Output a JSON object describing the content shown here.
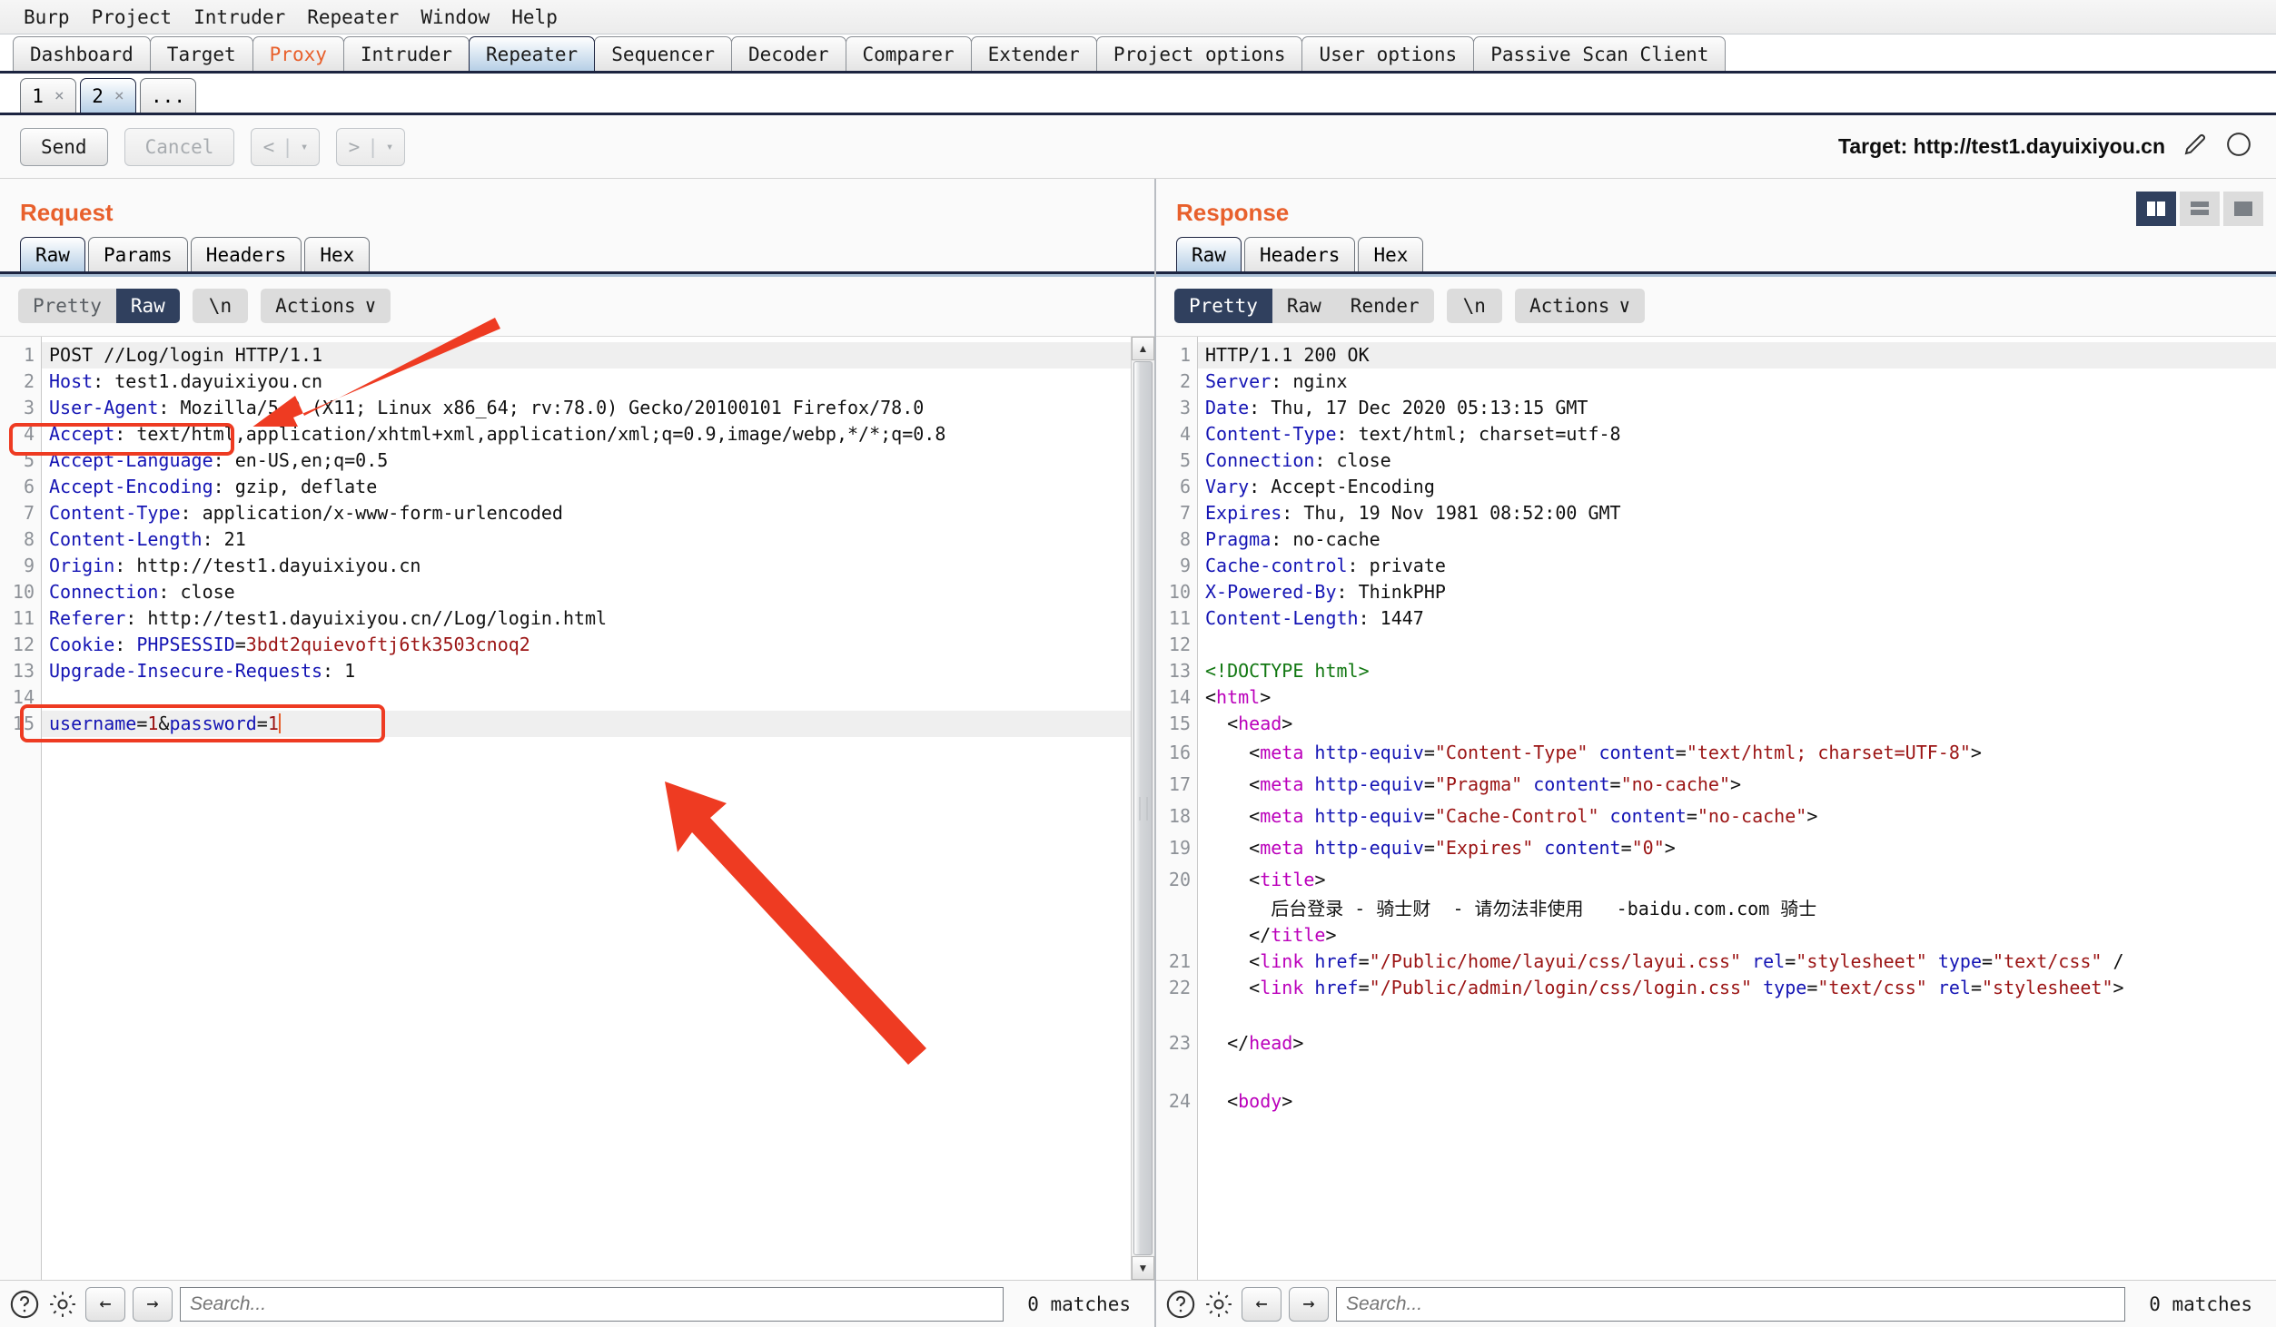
{
  "menu": {
    "items": [
      "Burp",
      "Project",
      "Intruder",
      "Repeater",
      "Window",
      "Help"
    ]
  },
  "main_tabs": [
    {
      "label": "Dashboard",
      "active": false
    },
    {
      "label": "Target",
      "active": false
    },
    {
      "label": "Proxy",
      "active": false
    },
    {
      "label": "Intruder",
      "active": false
    },
    {
      "label": "Repeater",
      "active": true
    },
    {
      "label": "Sequencer",
      "active": false
    },
    {
      "label": "Decoder",
      "active": false
    },
    {
      "label": "Comparer",
      "active": false
    },
    {
      "label": "Extender",
      "active": false
    },
    {
      "label": "Project options",
      "active": false
    },
    {
      "label": "User options",
      "active": false
    },
    {
      "label": "Passive Scan Client",
      "active": false
    }
  ],
  "repeater_tabs": [
    {
      "label": "1",
      "close": "×",
      "active": false
    },
    {
      "label": "2",
      "close": "×",
      "active": true
    },
    {
      "label": "...",
      "close": "",
      "active": false
    }
  ],
  "action_bar": {
    "send_label": "Send",
    "cancel_label": "Cancel",
    "back_label": "<",
    "forward_label": ">",
    "dropdown_glyph": "▾",
    "separator": "|",
    "target_label": "Target: http://test1.dayuixiyou.cn"
  },
  "request": {
    "title": "Request",
    "tabs": [
      {
        "label": "Raw",
        "active": true
      },
      {
        "label": "Params",
        "active": false
      },
      {
        "label": "Headers",
        "active": false
      },
      {
        "label": "Hex",
        "active": false
      }
    ],
    "view_modes": [
      {
        "label": "Pretty",
        "state": "dim"
      },
      {
        "label": "Raw",
        "state": "on"
      }
    ],
    "newline_label": "\\n",
    "actions_label": "Actions",
    "actions_chevron": "∨",
    "lines": [
      {
        "n": "1",
        "highlight": true,
        "tokens": [
          {
            "t": "POST //Log/login HTTP/1.1",
            "c": "val"
          }
        ]
      },
      {
        "n": "2",
        "highlight": false,
        "tokens": [
          {
            "t": "Host",
            "c": "hdr"
          },
          {
            "t": ": test1.dayuixiyou.cn",
            "c": "val"
          }
        ]
      },
      {
        "n": "3",
        "highlight": false,
        "tokens": [
          {
            "t": "User-Agent",
            "c": "hdr"
          },
          {
            "t": ": Mozilla/5.0 (X11; Linux x86_64; rv:78.0) Gecko/20100101 Firefox/78.0",
            "c": "val"
          }
        ]
      },
      {
        "n": "4",
        "highlight": false,
        "tokens": [
          {
            "t": "Accept",
            "c": "hdr"
          },
          {
            "t": ": text/html,application/xhtml+xml,application/xml;q=0.9,image/webp,*/*;q=0.8",
            "c": "val"
          }
        ]
      },
      {
        "n": "5",
        "highlight": false,
        "tokens": [
          {
            "t": "Accept-Language",
            "c": "hdr"
          },
          {
            "t": ": en-US,en;q=0.5",
            "c": "val"
          }
        ]
      },
      {
        "n": "6",
        "highlight": false,
        "tokens": [
          {
            "t": "Accept-Encoding",
            "c": "hdr"
          },
          {
            "t": ": gzip, deflate",
            "c": "val"
          }
        ]
      },
      {
        "n": "7",
        "highlight": false,
        "tokens": [
          {
            "t": "Content-Type",
            "c": "hdr"
          },
          {
            "t": ": application/x-www-form-urlencoded",
            "c": "val"
          }
        ]
      },
      {
        "n": "8",
        "highlight": false,
        "tokens": [
          {
            "t": "Content-Length",
            "c": "hdr"
          },
          {
            "t": ": 21",
            "c": "val"
          }
        ]
      },
      {
        "n": "9",
        "highlight": false,
        "tokens": [
          {
            "t": "Origin",
            "c": "hdr"
          },
          {
            "t": ": http://test1.dayuixiyou.cn",
            "c": "val"
          }
        ]
      },
      {
        "n": "10",
        "highlight": false,
        "tokens": [
          {
            "t": "Connection",
            "c": "hdr"
          },
          {
            "t": ": close",
            "c": "val"
          }
        ]
      },
      {
        "n": "11",
        "highlight": false,
        "tokens": [
          {
            "t": "Referer",
            "c": "hdr"
          },
          {
            "t": ": http://test1.dayuixiyou.cn//Log/login.html",
            "c": "val"
          }
        ]
      },
      {
        "n": "12",
        "highlight": false,
        "tokens": [
          {
            "t": "Cookie",
            "c": "hdr"
          },
          {
            "t": ": ",
            "c": "val"
          },
          {
            "t": "PHPSESSID",
            "c": "hdr"
          },
          {
            "t": "=",
            "c": "val"
          },
          {
            "t": "3bdt2quievoftj6tk3503cnoq2",
            "c": "cookieval"
          }
        ]
      },
      {
        "n": "13",
        "highlight": false,
        "tokens": [
          {
            "t": "Upgrade-Insecure-Requests",
            "c": "hdr"
          },
          {
            "t": ": 1",
            "c": "val"
          }
        ]
      },
      {
        "n": "14",
        "highlight": false,
        "tokens": [
          {
            "t": "",
            "c": "val"
          }
        ]
      },
      {
        "n": "15",
        "highlight": true,
        "tokens": [
          {
            "t": "username",
            "c": "hdr"
          },
          {
            "t": "=",
            "c": "val"
          },
          {
            "t": "1",
            "c": "aval"
          },
          {
            "t": "&",
            "c": "val"
          },
          {
            "t": "password",
            "c": "hdr"
          },
          {
            "t": "=",
            "c": "val"
          },
          {
            "t": "1",
            "c": "aval"
          }
        ],
        "caret": true
      }
    ],
    "search_placeholder": "Search...",
    "matches_label": "0 matches",
    "help_icon": "?",
    "gear_icon": "gear",
    "prev_icon": "←",
    "next_icon": "→"
  },
  "response": {
    "title": "Response",
    "tabs": [
      {
        "label": "Raw",
        "active": true
      },
      {
        "label": "Headers",
        "active": false
      },
      {
        "label": "Hex",
        "active": false
      }
    ],
    "view_modes": [
      {
        "label": "Pretty",
        "state": "on"
      },
      {
        "label": "Raw",
        "state": "plain"
      },
      {
        "label": "Render",
        "state": "plain"
      }
    ],
    "newline_label": "\\n",
    "actions_label": "Actions",
    "actions_chevron": "∨",
    "layout_buttons": [
      {
        "name": "split-vertical",
        "active": true
      },
      {
        "name": "split-horizontal",
        "active": false
      },
      {
        "name": "single-pane",
        "active": false
      }
    ],
    "lines": [
      {
        "n": "1",
        "highlight": true,
        "tall": false,
        "tokens": [
          {
            "t": "HTTP/1.1 200 OK",
            "c": "val"
          }
        ]
      },
      {
        "n": "2",
        "highlight": false,
        "tall": false,
        "tokens": [
          {
            "t": "Server",
            "c": "hdr"
          },
          {
            "t": ": nginx",
            "c": "val"
          }
        ]
      },
      {
        "n": "3",
        "highlight": false,
        "tall": false,
        "tokens": [
          {
            "t": "Date",
            "c": "hdr"
          },
          {
            "t": ": Thu, 17 Dec 2020 05:13:15 GMT",
            "c": "val"
          }
        ]
      },
      {
        "n": "4",
        "highlight": false,
        "tall": false,
        "tokens": [
          {
            "t": "Content-Type",
            "c": "hdr"
          },
          {
            "t": ": text/html; charset=utf-8",
            "c": "val"
          }
        ]
      },
      {
        "n": "5",
        "highlight": false,
        "tall": false,
        "tokens": [
          {
            "t": "Connection",
            "c": "hdr"
          },
          {
            "t": ": close",
            "c": "val"
          }
        ]
      },
      {
        "n": "6",
        "highlight": false,
        "tall": false,
        "tokens": [
          {
            "t": "Vary",
            "c": "hdr"
          },
          {
            "t": ": Accept-Encoding",
            "c": "val"
          }
        ]
      },
      {
        "n": "7",
        "highlight": false,
        "tall": false,
        "tokens": [
          {
            "t": "Expires",
            "c": "hdr"
          },
          {
            "t": ": Thu, 19 Nov 1981 08:52:00 GMT",
            "c": "val"
          }
        ]
      },
      {
        "n": "8",
        "highlight": false,
        "tall": false,
        "tokens": [
          {
            "t": "Pragma",
            "c": "hdr"
          },
          {
            "t": ": no-cache",
            "c": "val"
          }
        ]
      },
      {
        "n": "9",
        "highlight": false,
        "tall": false,
        "tokens": [
          {
            "t": "Cache-control",
            "c": "hdr"
          },
          {
            "t": ": private",
            "c": "val"
          }
        ]
      },
      {
        "n": "10",
        "highlight": false,
        "tall": false,
        "tokens": [
          {
            "t": "X-Powered-By",
            "c": "hdr"
          },
          {
            "t": ": ThinkPHP",
            "c": "val"
          }
        ]
      },
      {
        "n": "11",
        "highlight": false,
        "tall": false,
        "tokens": [
          {
            "t": "Content-Length",
            "c": "hdr"
          },
          {
            "t": ": 1447",
            "c": "val"
          }
        ]
      },
      {
        "n": "12",
        "highlight": false,
        "tall": false,
        "tokens": [
          {
            "t": "",
            "c": "val"
          }
        ]
      },
      {
        "n": "13",
        "highlight": false,
        "tall": false,
        "tokens": [
          {
            "t": "<!DOCTYPE html>",
            "c": "doct"
          }
        ]
      },
      {
        "n": "14",
        "highlight": false,
        "tall": false,
        "tokens": [
          {
            "t": "<",
            "c": "punc"
          },
          {
            "t": "html",
            "c": "tagc"
          },
          {
            "t": ">",
            "c": "punc"
          }
        ]
      },
      {
        "n": "15",
        "highlight": false,
        "tall": false,
        "tokens": [
          {
            "t": "  <",
            "c": "punc"
          },
          {
            "t": "head",
            "c": "tagc"
          },
          {
            "t": ">",
            "c": "punc"
          }
        ]
      },
      {
        "n": "16",
        "highlight": false,
        "tall": true,
        "tokens": [
          {
            "t": "    <",
            "c": "punc"
          },
          {
            "t": "meta",
            "c": "tagc"
          },
          {
            "t": " http-equiv",
            "c": "attr"
          },
          {
            "t": "=",
            "c": "punc"
          },
          {
            "t": "\"Content-Type\"",
            "c": "aval"
          },
          {
            "t": " content",
            "c": "attr"
          },
          {
            "t": "=",
            "c": "punc"
          },
          {
            "t": "\"text/html; charset=UTF-8\"",
            "c": "aval"
          },
          {
            "t": ">",
            "c": "punc"
          }
        ]
      },
      {
        "n": "17",
        "highlight": false,
        "tall": true,
        "tokens": [
          {
            "t": "    <",
            "c": "punc"
          },
          {
            "t": "meta",
            "c": "tagc"
          },
          {
            "t": " http-equiv",
            "c": "attr"
          },
          {
            "t": "=",
            "c": "punc"
          },
          {
            "t": "\"Pragma\"",
            "c": "aval"
          },
          {
            "t": " content",
            "c": "attr"
          },
          {
            "t": "=",
            "c": "punc"
          },
          {
            "t": "\"no-cache\"",
            "c": "aval"
          },
          {
            "t": ">",
            "c": "punc"
          }
        ]
      },
      {
        "n": "18",
        "highlight": false,
        "tall": true,
        "tokens": [
          {
            "t": "    <",
            "c": "punc"
          },
          {
            "t": "meta",
            "c": "tagc"
          },
          {
            "t": " http-equiv",
            "c": "attr"
          },
          {
            "t": "=",
            "c": "punc"
          },
          {
            "t": "\"Cache-Control\"",
            "c": "aval"
          },
          {
            "t": " content",
            "c": "attr"
          },
          {
            "t": "=",
            "c": "punc"
          },
          {
            "t": "\"no-cache\"",
            "c": "aval"
          },
          {
            "t": ">",
            "c": "punc"
          }
        ]
      },
      {
        "n": "19",
        "highlight": false,
        "tall": true,
        "tokens": [
          {
            "t": "    <",
            "c": "punc"
          },
          {
            "t": "meta",
            "c": "tagc"
          },
          {
            "t": " http-equiv",
            "c": "attr"
          },
          {
            "t": "=",
            "c": "punc"
          },
          {
            "t": "\"Expires\"",
            "c": "aval"
          },
          {
            "t": " content",
            "c": "attr"
          },
          {
            "t": "=",
            "c": "punc"
          },
          {
            "t": "\"0\"",
            "c": "aval"
          },
          {
            "t": ">",
            "c": "punc"
          }
        ]
      },
      {
        "n": "20",
        "highlight": false,
        "tall": true,
        "tokens": [
          {
            "t": "    <",
            "c": "punc"
          },
          {
            "t": "title",
            "c": "tagc"
          },
          {
            "t": ">",
            "c": "punc"
          }
        ]
      },
      {
        "n": "",
        "highlight": false,
        "tall": false,
        "tokens": [
          {
            "t": "      后台登录 - 骑士财  - 请勿法非使用   -baidu.com.com 骑士",
            "c": "val"
          }
        ]
      },
      {
        "n": "",
        "highlight": false,
        "tall": false,
        "tokens": [
          {
            "t": "    </",
            "c": "punc"
          },
          {
            "t": "title",
            "c": "tagc"
          },
          {
            "t": ">",
            "c": "punc"
          }
        ]
      },
      {
        "n": "21",
        "highlight": false,
        "tall": false,
        "tokens": [
          {
            "t": "    <",
            "c": "punc"
          },
          {
            "t": "link",
            "c": "tagc"
          },
          {
            "t": " href",
            "c": "attr"
          },
          {
            "t": "=",
            "c": "punc"
          },
          {
            "t": "\"/Public/home/layui/css/layui.css\"",
            "c": "aval"
          },
          {
            "t": " rel",
            "c": "attr"
          },
          {
            "t": "=",
            "c": "punc"
          },
          {
            "t": "\"stylesheet\"",
            "c": "aval"
          },
          {
            "t": " type",
            "c": "attr"
          },
          {
            "t": "=",
            "c": "punc"
          },
          {
            "t": "\"text/css\"",
            "c": "aval"
          },
          {
            "t": " /",
            "c": "punc"
          }
        ]
      },
      {
        "n": "22",
        "highlight": false,
        "tall": false,
        "tokens": [
          {
            "t": "    <",
            "c": "punc"
          },
          {
            "t": "link",
            "c": "tagc"
          },
          {
            "t": " href",
            "c": "attr"
          },
          {
            "t": "=",
            "c": "punc"
          },
          {
            "t": "\"/Public/admin/login/css/login.css\"",
            "c": "aval"
          },
          {
            "t": " type",
            "c": "attr"
          },
          {
            "t": "=",
            "c": "punc"
          },
          {
            "t": "\"text/css\"",
            "c": "aval"
          },
          {
            "t": " rel",
            "c": "attr"
          },
          {
            "t": "=",
            "c": "punc"
          },
          {
            "t": "\"stylesheet\"",
            "c": "aval"
          },
          {
            "t": ">",
            "c": "punc"
          }
        ]
      },
      {
        "n": "",
        "highlight": false,
        "tall": false,
        "tokens": [
          {
            "t": "",
            "c": "val"
          }
        ]
      },
      {
        "n": "23",
        "highlight": false,
        "tall": true,
        "tokens": [
          {
            "t": "  </",
            "c": "punc"
          },
          {
            "t": "head",
            "c": "tagc"
          },
          {
            "t": ">",
            "c": "punc"
          }
        ]
      },
      {
        "n": "",
        "highlight": false,
        "tall": false,
        "tokens": [
          {
            "t": "",
            "c": "val"
          }
        ]
      },
      {
        "n": "24",
        "highlight": false,
        "tall": true,
        "tokens": [
          {
            "t": "  <",
            "c": "punc"
          },
          {
            "t": "body",
            "c": "tagc"
          },
          {
            "t": ">",
            "c": "punc"
          }
        ]
      }
    ],
    "search_placeholder": "Search...",
    "matches_label": "0 matches",
    "help_icon": "?",
    "gear_icon": "gear",
    "prev_icon": "←",
    "next_icon": "→"
  },
  "annotations": {
    "highlight_boxes": [
      {
        "name": "request-line-box",
        "label": "POST //Log/login HTTP/1.1"
      },
      {
        "name": "cookie-line-box",
        "label": "Cookie: PHPSESSID=3bdt2quievoftj6tk3503cnoq2"
      }
    ],
    "arrows": [
      {
        "name": "arrow-to-request-line"
      },
      {
        "name": "arrow-to-body-params"
      }
    ],
    "color": "#ee3b22"
  }
}
